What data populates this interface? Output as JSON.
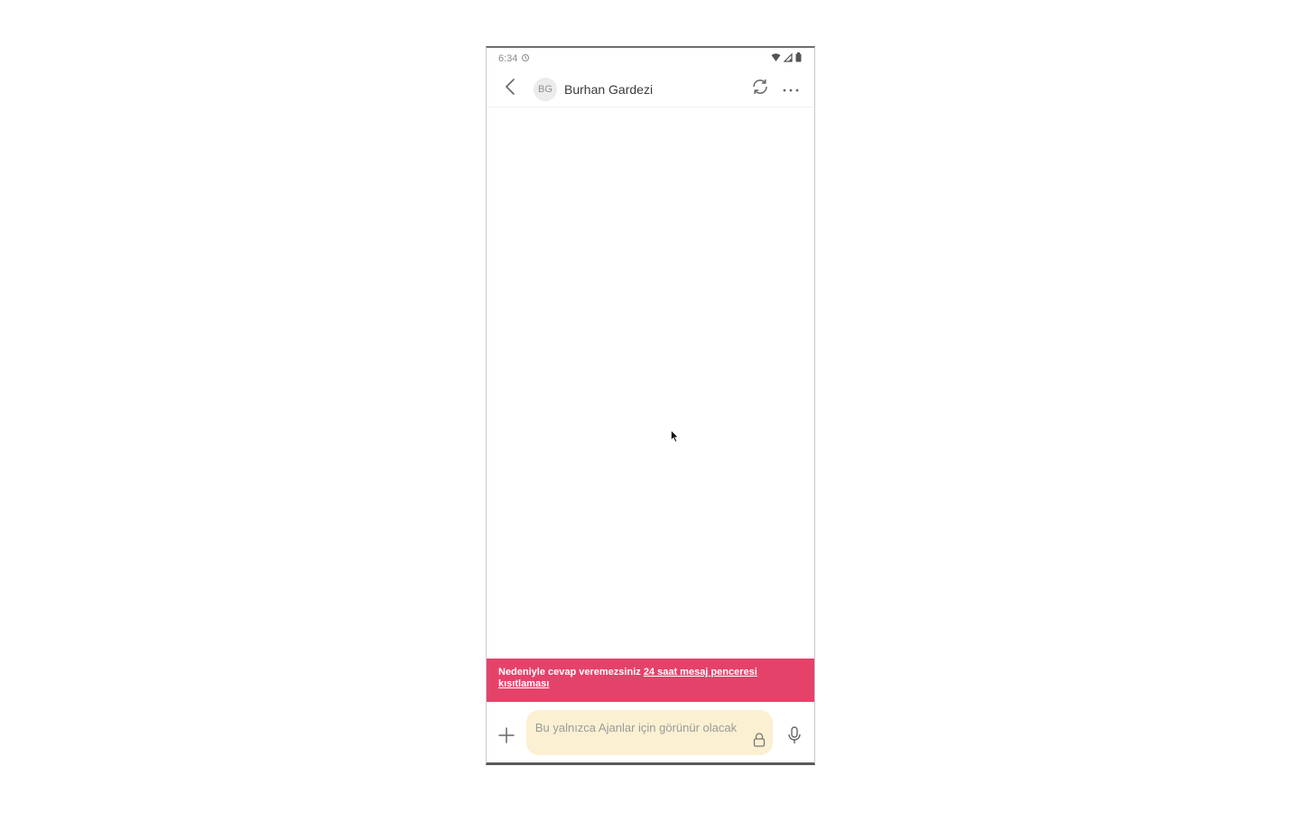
{
  "status_bar": {
    "time": "6:34",
    "sync_icon": "sync-status-icon",
    "icons": [
      "wifi-icon",
      "signal-icon",
      "battery-icon"
    ]
  },
  "header": {
    "back_icon": "back-arrow-icon",
    "avatar_initials": "BG",
    "contact_name": "Burhan Gardezi",
    "refresh_icon": "refresh-icon",
    "more_icon": "more-options-icon"
  },
  "banner": {
    "text_prefix": "Nedeniyle cevap veremezsiniz ",
    "link_text": "24 saat mesaj penceresi kısıtlaması",
    "background": "#e5426a"
  },
  "composer": {
    "plus_icon": "plus-icon",
    "placeholder": "Bu yalnızca Ajanlar için görünür olacak",
    "lock_icon": "lock-icon",
    "mic_icon": "microphone-icon",
    "input_background": "#fbf0d2"
  }
}
